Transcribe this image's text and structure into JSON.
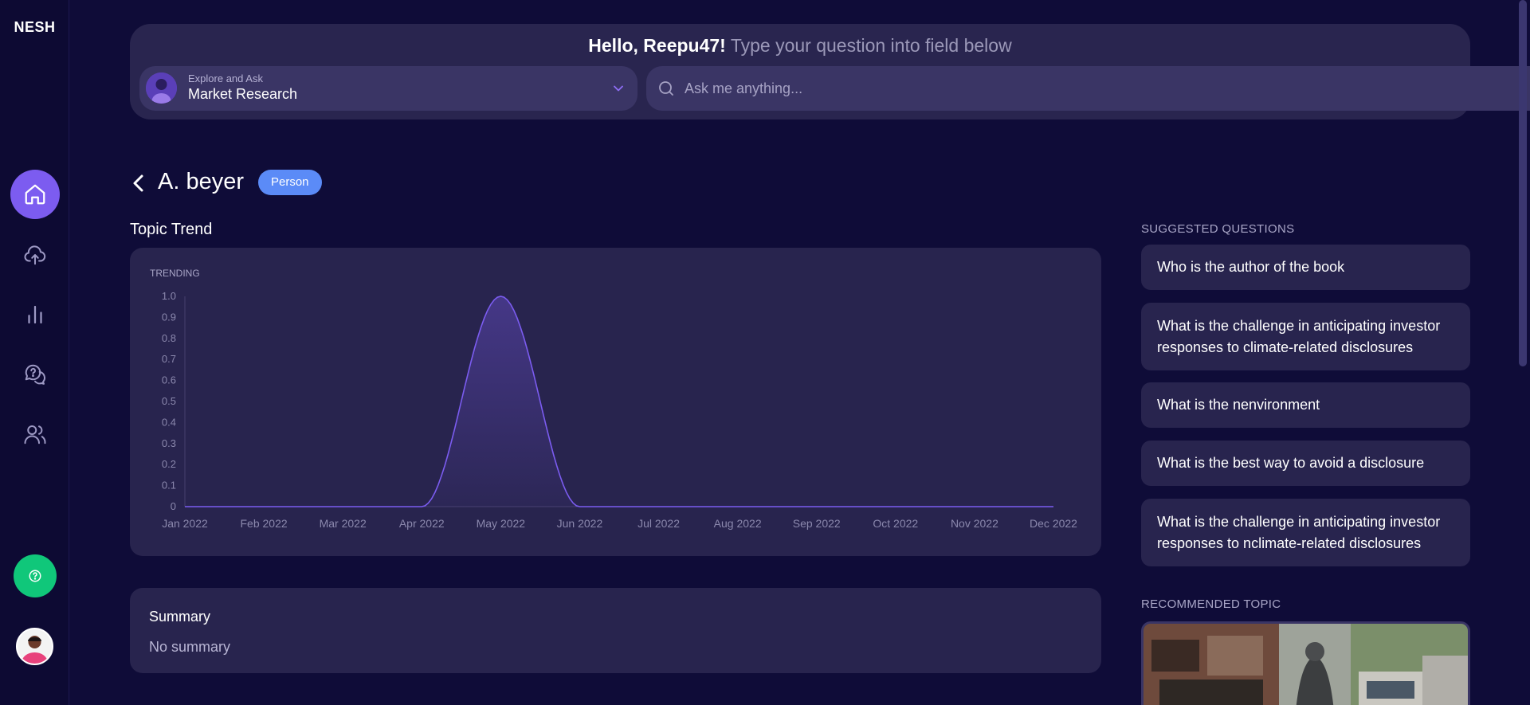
{
  "app": {
    "logo": "NESH"
  },
  "sidebar": {
    "items": [
      {
        "name": "home",
        "icon": "home-icon"
      },
      {
        "name": "upload",
        "icon": "cloud-upload-icon"
      },
      {
        "name": "analytics",
        "icon": "bar-chart-icon"
      },
      {
        "name": "questions",
        "icon": "question-chat-icon"
      },
      {
        "name": "users",
        "icon": "users-icon"
      }
    ],
    "help_icon": "question-circle-icon"
  },
  "header": {
    "greeting": "Hello, Reepu47!",
    "hint": "Type your question into field below",
    "selector": {
      "small": "Explore and Ask",
      "value": "Market Research"
    },
    "search": {
      "placeholder": "Ask me anything..."
    }
  },
  "entity": {
    "title": "A. beyer",
    "badge": "Person"
  },
  "topic_trend": {
    "heading": "Topic Trend"
  },
  "chart_data": {
    "type": "area",
    "title": "TRENDING",
    "x": [
      "Jan 2022",
      "Feb 2022",
      "Mar 2022",
      "Apr 2022",
      "May 2022",
      "Jun 2022",
      "Jul 2022",
      "Aug 2022",
      "Sep 2022",
      "Oct 2022",
      "Nov 2022",
      "Dec 2022"
    ],
    "values": [
      0,
      0,
      0,
      0,
      1,
      0,
      0,
      0,
      0,
      0,
      0,
      0
    ],
    "ylim": [
      0,
      1
    ],
    "yticks": [
      "0",
      "0.1",
      "0.2",
      "0.3",
      "0.4",
      "0.5",
      "0.6",
      "0.7",
      "0.8",
      "0.9",
      "1.0"
    ],
    "color": "#7b5cf0",
    "grid": false,
    "legend": "none"
  },
  "summary": {
    "title": "Summary",
    "text": "No summary"
  },
  "suggested": {
    "heading": "SUGGESTED QUESTIONS",
    "items": [
      "Who is the author of the book",
      "What is the challenge in anticipating investor responses to climate-related disclosures",
      "What is the nenvironment",
      "What is the best way to avoid a disclosure",
      "What is the challenge in anticipating investor responses to nclimate-related disclosures"
    ]
  },
  "recommended": {
    "heading": "RECOMMENDED TOPIC"
  },
  "colors": {
    "accent": "#7c5cf0",
    "badge": "#5b8bf7",
    "help": "#10c77a",
    "background": "#0f0c38"
  }
}
